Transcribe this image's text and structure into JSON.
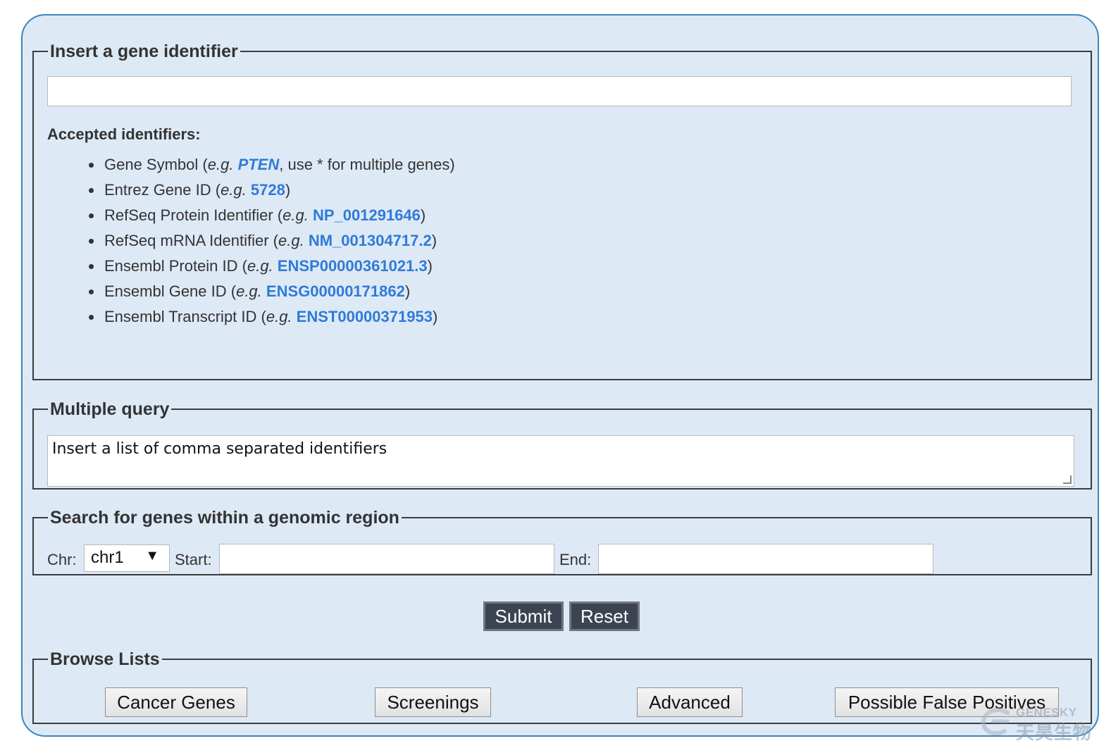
{
  "gene_section": {
    "legend": "Insert a gene identifier",
    "input_value": "",
    "accepted_title": "Accepted identifiers:",
    "eg": "e.g.",
    "items": [
      {
        "prefix": "Gene Symbol (",
        "example": "PTEN",
        "suffix": ", use * for multiple genes)"
      },
      {
        "prefix": "Entrez Gene ID (",
        "example": "5728",
        "suffix": ")"
      },
      {
        "prefix": "RefSeq Protein Identifier (",
        "example": "NP_001291646",
        "suffix": ")"
      },
      {
        "prefix": "RefSeq mRNA Identifier (",
        "example": "NM_001304717.2",
        "suffix": ")"
      },
      {
        "prefix": "Ensembl Protein ID (",
        "example": "ENSP00000361021.3",
        "suffix": ")"
      },
      {
        "prefix": "Ensembl Gene ID (",
        "example": "ENSG00000171862",
        "suffix": ")"
      },
      {
        "prefix": "Ensembl Transcript ID (",
        "example": "ENST00000371953",
        "suffix": ")"
      }
    ]
  },
  "multiple_query": {
    "legend": "Multiple query",
    "placeholder": "Insert a list of comma separated identifiers"
  },
  "region": {
    "legend": "Search for genes within a genomic region",
    "chr_label": "Chr:",
    "chr_value": "chr1",
    "chr_arrow": "▼",
    "start_label": "Start:",
    "start_value": "",
    "end_label": "End:",
    "end_value": ""
  },
  "actions": {
    "submit": "Submit",
    "reset": "Reset"
  },
  "browse": {
    "legend": "Browse Lists",
    "buttons": [
      "Cancer Genes",
      "Screenings",
      "Advanced",
      "Possible False Positives"
    ]
  },
  "watermark": {
    "top": "GENESKY",
    "bottom": "天昊生物"
  },
  "colors": {
    "panel_bg": "#dee9f6",
    "panel_border": "#3a86b9",
    "link": "#2f7bd6",
    "dark_button": "#3d4451"
  }
}
